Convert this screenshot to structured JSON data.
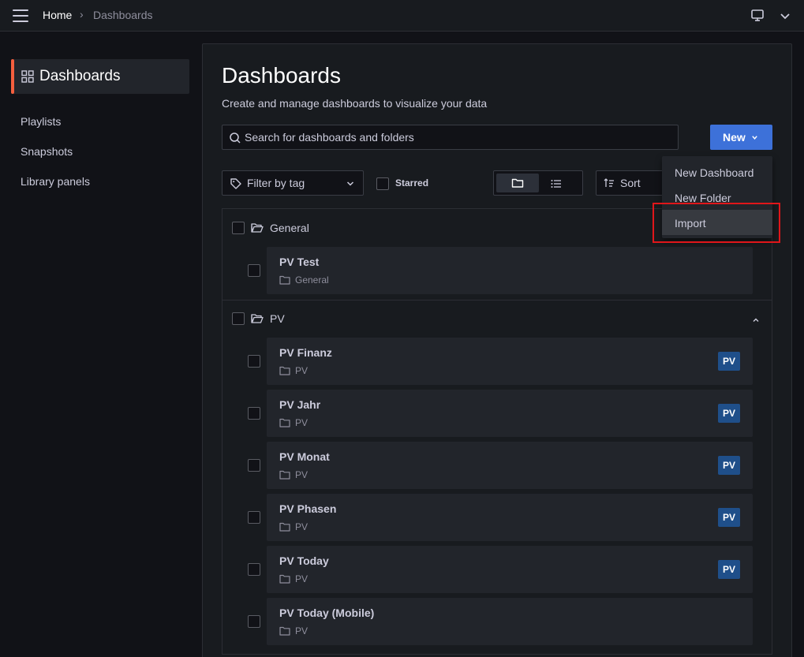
{
  "topbar": {
    "breadcrumb_home": "Home",
    "breadcrumb_separator": "›",
    "breadcrumb_current": "Dashboards",
    "icons": [
      "menu-icon",
      "tv-mode-icon",
      "chevron-down-icon"
    ]
  },
  "sidebar": {
    "active_label": "Dashboards",
    "items": [
      {
        "label": "Playlists"
      },
      {
        "label": "Snapshots"
      },
      {
        "label": "Library panels"
      }
    ]
  },
  "page": {
    "title": "Dashboards",
    "subtitle": "Create and manage dashboards to visualize your data"
  },
  "search": {
    "placeholder": "Search for dashboards and folders",
    "value": ""
  },
  "toolbar": {
    "new_label": "New",
    "filter_label": "Filter by tag",
    "starred_label": "Starred",
    "sort_label": "Sort",
    "view_mode": "folders"
  },
  "new_menu": {
    "items": [
      {
        "label": "New Dashboard"
      },
      {
        "label": "New Folder"
      },
      {
        "label": "Import"
      }
    ],
    "highlighted": "Import"
  },
  "folders": [
    {
      "name": "General",
      "dashboards": [
        {
          "title": "PV Test",
          "folder": "General",
          "tag": ""
        }
      ]
    },
    {
      "name": "PV",
      "dashboards": [
        {
          "title": "PV Finanz",
          "folder": "PV",
          "tag": "PV"
        },
        {
          "title": "PV Jahr",
          "folder": "PV",
          "tag": "PV"
        },
        {
          "title": "PV Monat",
          "folder": "PV",
          "tag": "PV"
        },
        {
          "title": "PV Phasen",
          "folder": "PV",
          "tag": "PV"
        },
        {
          "title": "PV Today",
          "folder": "PV",
          "tag": "PV"
        },
        {
          "title": "PV Today (Mobile)",
          "folder": "PV",
          "tag": ""
        }
      ]
    }
  ],
  "colors": {
    "background": "#111217",
    "panel": "#181b1f",
    "card": "#22252b",
    "primary": "#3d71d9",
    "active_accent": "#f55f3e",
    "tag": "#1f4f8a",
    "highlight": "#e0161a"
  }
}
